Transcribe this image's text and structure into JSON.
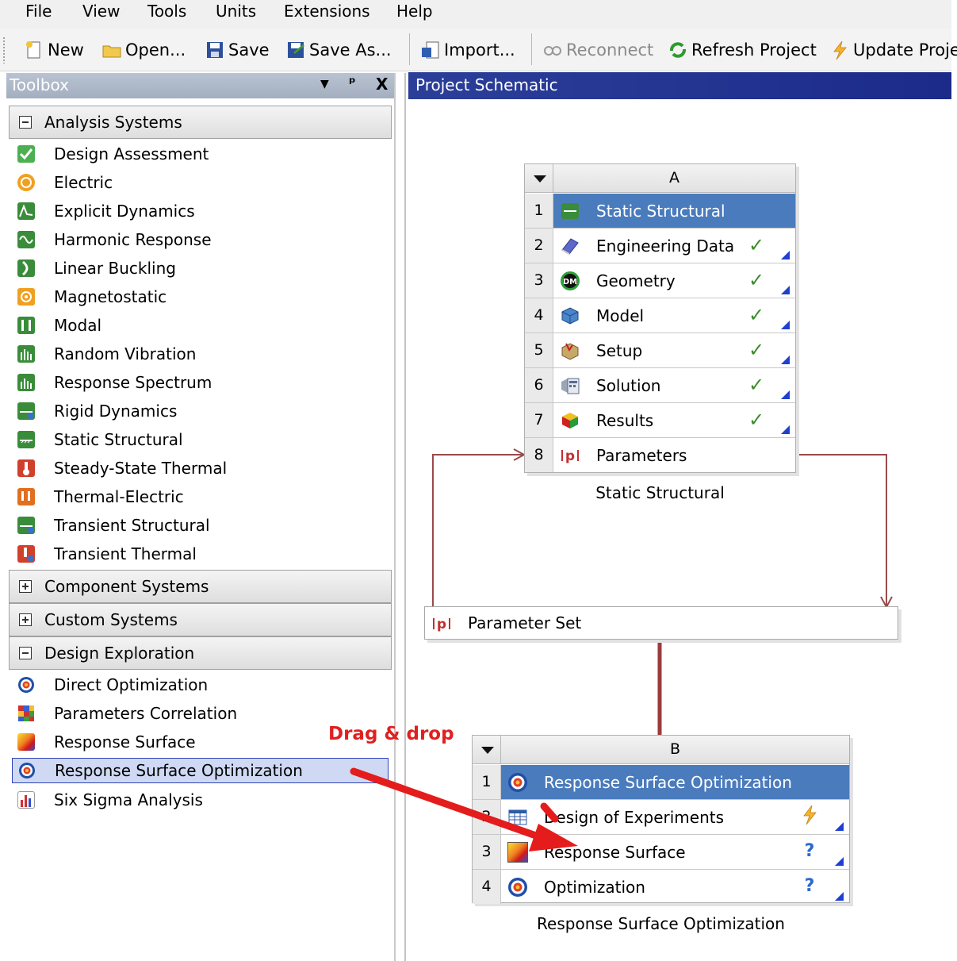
{
  "menu": [
    "File",
    "View",
    "Tools",
    "Units",
    "Extensions",
    "Help"
  ],
  "toolbar": {
    "new": "New",
    "open": "Open...",
    "save": "Save",
    "save_as": "Save As...",
    "import": "Import...",
    "reconnect": "Reconnect",
    "refresh": "Refresh Project",
    "update": "Update Proje"
  },
  "toolbox": {
    "title": "Toolbox",
    "pin": "ᵖ",
    "close": "X",
    "categories": {
      "analysis": "Analysis Systems",
      "component": "Component Systems",
      "custom": "Custom Systems",
      "design": "Design Exploration"
    },
    "analysis_items": [
      "Design Assessment",
      "Electric",
      "Explicit Dynamics",
      "Harmonic Response",
      "Linear Buckling",
      "Magnetostatic",
      "Modal",
      "Random Vibration",
      "Response Spectrum",
      "Rigid Dynamics",
      "Static Structural",
      "Steady-State Thermal",
      "Thermal-Electric",
      "Transient Structural",
      "Transient Thermal"
    ],
    "design_items": [
      "Direct Optimization",
      "Parameters Correlation",
      "Response Surface",
      "Response Surface Optimization",
      "Six Sigma Analysis"
    ]
  },
  "schematic": {
    "title": "Project Schematic",
    "system_a": {
      "column": "A",
      "caption": "Static Structural",
      "rows": [
        {
          "num": "1",
          "label": "Static Structural"
        },
        {
          "num": "2",
          "label": "Engineering Data"
        },
        {
          "num": "3",
          "label": "Geometry"
        },
        {
          "num": "4",
          "label": "Model"
        },
        {
          "num": "5",
          "label": "Setup"
        },
        {
          "num": "6",
          "label": "Solution"
        },
        {
          "num": "7",
          "label": "Results"
        },
        {
          "num": "8",
          "label": "Parameters"
        }
      ],
      "geometry_icon_text": "DM"
    },
    "parameter_set": "Parameter Set",
    "system_b": {
      "column": "B",
      "caption": "Response Surface Optimization",
      "rows": [
        {
          "num": "1",
          "label": "Response Surface Optimization"
        },
        {
          "num": "2",
          "label": "Design of Experiments"
        },
        {
          "num": "3",
          "label": "Response Surface"
        },
        {
          "num": "4",
          "label": "Optimization"
        }
      ]
    },
    "annotation": "Drag & drop"
  },
  "colors": {
    "header_blue": "#1c2a8a",
    "selected_cell": "#4a7bbd",
    "link": "#9b4a4a",
    "annotation": "#e02020",
    "check": "#3c8c2c"
  },
  "status_glyphs": {
    "check": "✓",
    "lightning": "⚡",
    "question": "?"
  }
}
